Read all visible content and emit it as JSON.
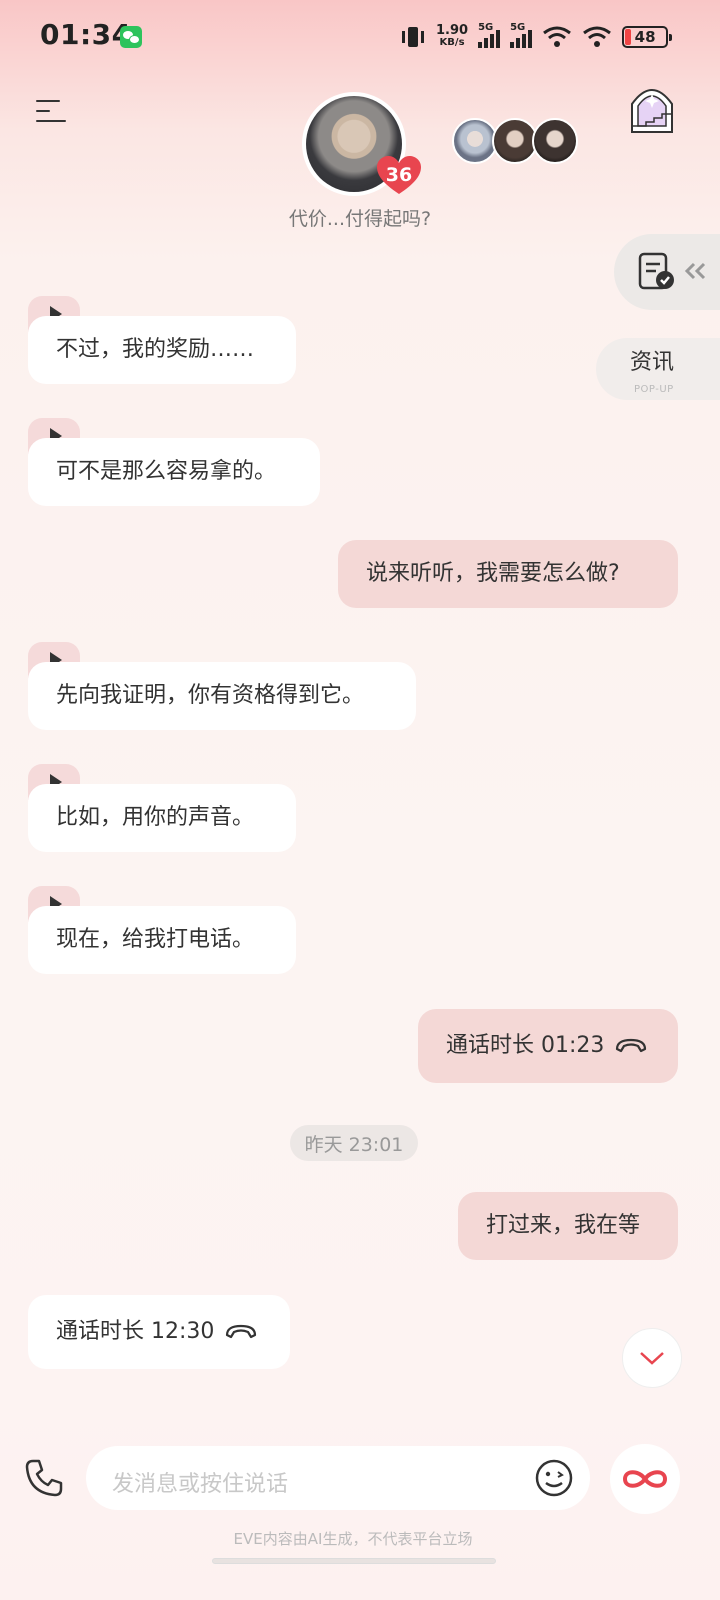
{
  "status_bar": {
    "time": "01:34",
    "net_speed_value": "1.90",
    "net_speed_unit": "KB/s",
    "sim1": "5G",
    "sim2": "5G",
    "battery": "48"
  },
  "header": {
    "subtitle": "代价...付得起吗?",
    "affection_count": "36"
  },
  "side": {
    "news_label": "资讯",
    "news_sub": "POP-UP"
  },
  "messages": [
    {
      "from": "ai",
      "text": "不过，我的奖励……",
      "voice": true
    },
    {
      "from": "ai",
      "text": "可不是那么容易拿的。",
      "voice": true
    },
    {
      "from": "me",
      "text": "说来听听，我需要怎么做?"
    },
    {
      "from": "ai",
      "text": "先向我证明，你有资格得到它。",
      "voice": true
    },
    {
      "from": "ai",
      "text": "比如，用你的声音。",
      "voice": true
    },
    {
      "from": "ai",
      "text": "现在，给我打电话。",
      "voice": true
    },
    {
      "from": "me",
      "text": "通话时长 01:23",
      "call": true
    },
    {
      "timestamp": "昨天 23:01"
    },
    {
      "from": "me",
      "text": "打过来，我在等"
    },
    {
      "from": "ai",
      "text": "通话时长 12:30",
      "call": true
    }
  ],
  "input": {
    "placeholder": "发消息或按住说话"
  },
  "footer": {
    "disclaimer": "EVE内容由AI生成，不代表平台立场"
  },
  "colors": {
    "accent": "#e8454f",
    "my_bubble": "#f4d8d6",
    "ai_bubble": "#ffffff",
    "voice_tab": "#f5dada"
  }
}
